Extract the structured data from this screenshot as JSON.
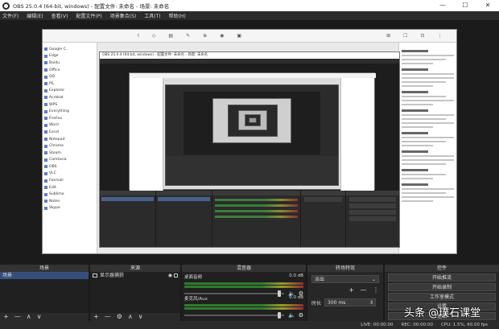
{
  "window": {
    "title": "OBS 25.0.4 (64-bit, windows) - 配置文件: 未命名 - 场景: 未命名",
    "minimize": "—",
    "maximize": "☐",
    "close": "✕"
  },
  "menu": [
    "文件(F)",
    "编辑(E)",
    "查看(V)",
    "配置文件(P)",
    "场景集合(S)",
    "工具(T)",
    "帮助(H)"
  ],
  "preview": {
    "nested_title": "OBS 25.0.4 (64-bit, windows) - 配置文件: 未命名 - 场景: 未命名",
    "left_list": [
      "Google C..",
      "Edge",
      "Baidu",
      "Office",
      "QQ",
      "PS",
      "Explorer",
      "Acrobat",
      "WPS",
      "Everything",
      "FireFox",
      "Word",
      "Excel",
      "Notepad",
      "Chrome",
      "Steam",
      "Camtasia",
      "OBS",
      "VLC",
      "Foxmail",
      "Edit",
      "Sublime",
      "Notes",
      "Skype"
    ]
  },
  "docks": {
    "scenes": {
      "header": "场景",
      "items": [
        {
          "label": "场景",
          "selected": true
        }
      ],
      "footer": [
        "+",
        "—",
        "∧",
        "∨"
      ]
    },
    "sources": {
      "header": "来源",
      "items": [
        {
          "label": "显示器捕获",
          "icon": "monitor-icon"
        }
      ],
      "footer": [
        "+",
        "—",
        "⚙",
        "∧",
        "∨"
      ]
    },
    "mixer": {
      "header": "混音器",
      "channels": [
        {
          "name": "桌面音频",
          "db": "0.0 dB",
          "volume_fraction": 0.97
        },
        {
          "name": "麦克风/Aux",
          "db": "0.0 dB",
          "volume_fraction": 0.97
        }
      ]
    },
    "transitions": {
      "header": "转场特效",
      "selected": "淡出",
      "duration_label": "时长",
      "duration_value": "300 ms"
    },
    "controls": {
      "header": "控件",
      "buttons": [
        "开始推流",
        "开始录制",
        "工作室模式",
        "设置",
        "退出"
      ]
    }
  },
  "status": {
    "live": "LIVE: 00:00:00",
    "rec": "REC: 00:00:00",
    "cpu": "CPU: 1.5%, 60.00 fps"
  },
  "watermark": "头条 @璞石课堂",
  "colors": {
    "selected": "#364e79",
    "background": "#272727",
    "titlebar": "#ffffff"
  }
}
